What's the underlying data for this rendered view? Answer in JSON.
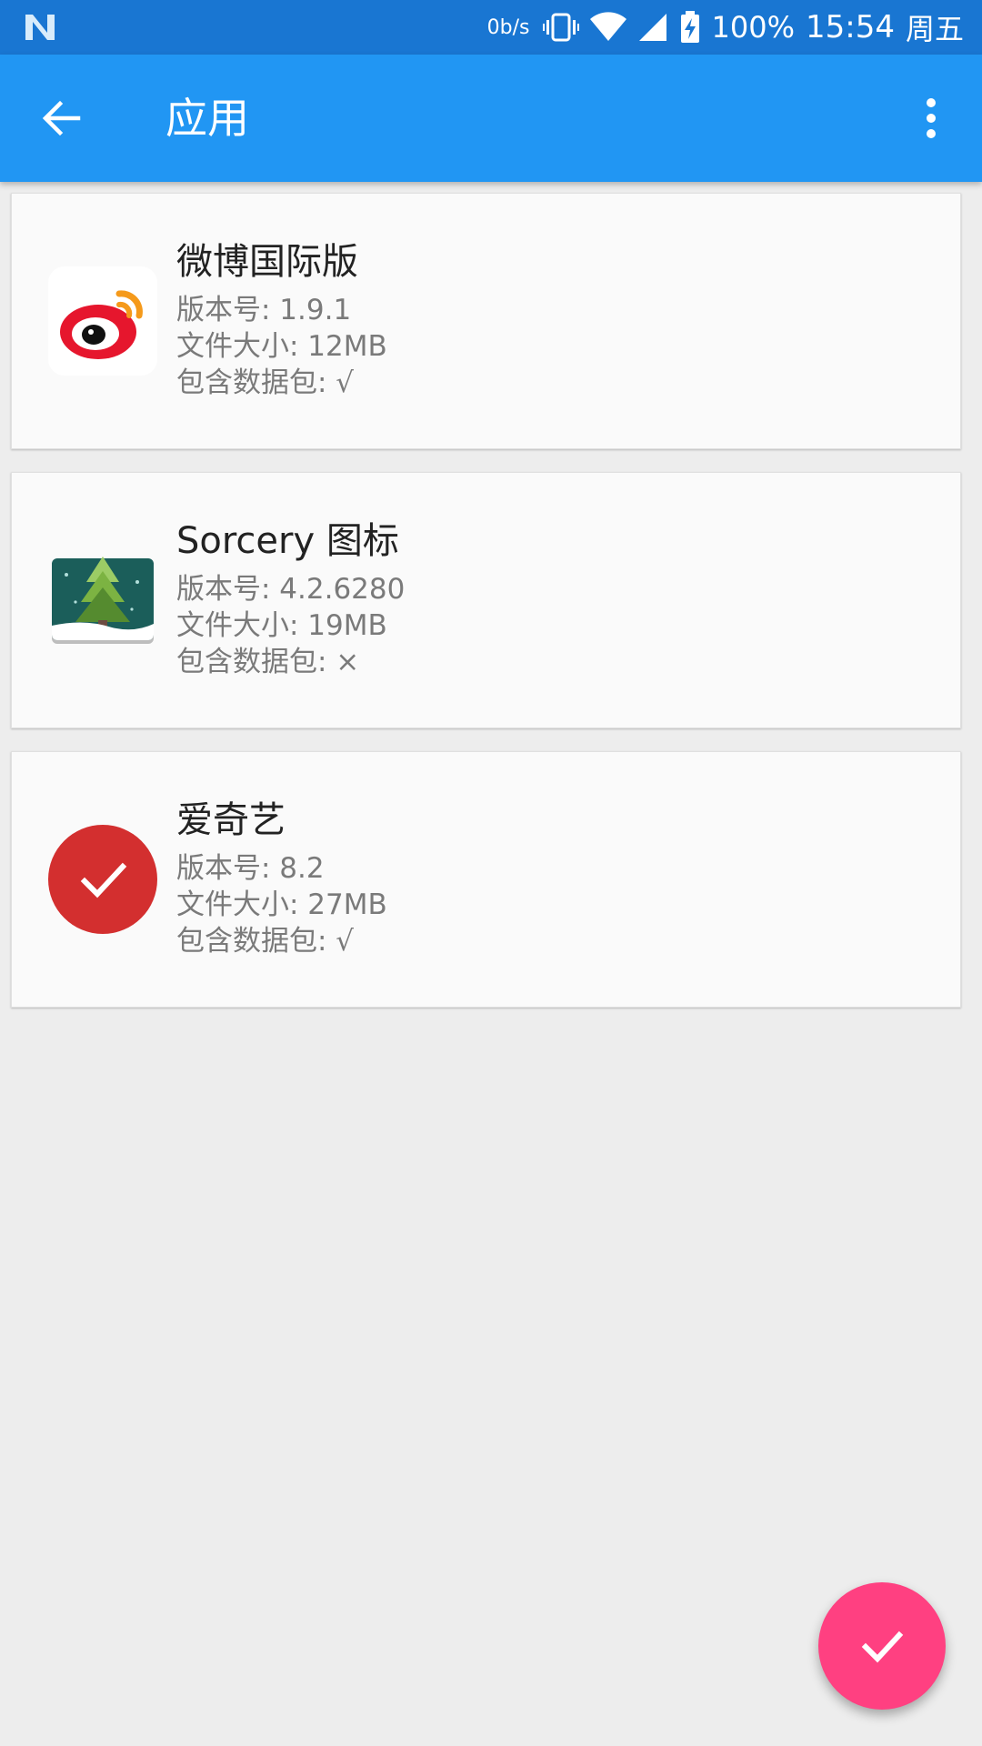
{
  "status_bar": {
    "logo_icon": "nougat-n-icon",
    "net_speed": "0b/s",
    "battery": "100%",
    "time": "15:54",
    "day": "周五",
    "icons": [
      "vibrate-icon",
      "wifi-icon",
      "cell-signal-icon",
      "battery-charging-icon"
    ]
  },
  "app_bar": {
    "title": "应用",
    "back_icon": "arrow-left-icon",
    "menu_icon": "more-vertical-icon",
    "background": "#2196f3"
  },
  "apps": [
    {
      "name": "微博国际版",
      "version": "版本号: 1.9.1",
      "size": "文件大小: 12MB",
      "data_pack": "包含数据包: √",
      "icon": "weibo-icon",
      "selected": false
    },
    {
      "name": "Sorcery 图标",
      "version": "版本号: 4.2.6280",
      "size": "文件大小: 19MB",
      "data_pack": "包含数据包: ×",
      "icon": "pine-tree-icon",
      "selected": false
    },
    {
      "name": "爱奇艺",
      "version": "版本号: 8.2",
      "size": "文件大小: 27MB",
      "data_pack": "包含数据包: √",
      "icon": "check-icon",
      "selected": true
    }
  ],
  "fab": {
    "icon": "check-icon",
    "color": "#ff4081"
  },
  "colors": {
    "status_bar": "#1976d2",
    "selected": "#d32f2f"
  }
}
